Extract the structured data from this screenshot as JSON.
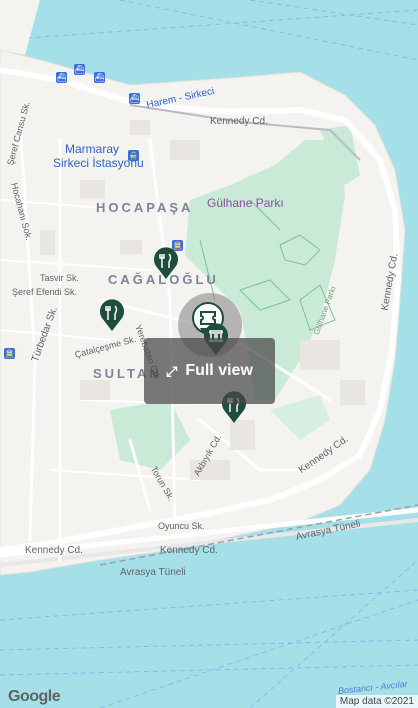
{
  "labels": {
    "kennedy_top": "Kennedy Cd.",
    "harem": "Harem - Sirkeci",
    "marmaray1": "Marmaray",
    "marmaray2": "Sirkeci İstasyonu",
    "hocapasa": "HOCAPAŞA",
    "gulhane": "Gülhane Parkı",
    "cagaloglu": "CAĞALOĞLU",
    "sultan": "SULTAN",
    "serif": "Şeref Cansu Sk.",
    "hocahani": "Hocahanı Sok.",
    "tasvir": "Tasvir Sk.",
    "seref": "Şeref Efendi Sk.",
    "turbedar": "Türbedar Sk.",
    "catalcesme": "Çatalçeşme Sk.",
    "yerebatan": "Yerebatan Cd.",
    "gulhane_parki_small": "Gülhane Parkı",
    "kennedy_right": "Kennedy Cd.",
    "kennedy_right2": "Kennedy Cd.",
    "torun": "Torun Sk.",
    "akbiyik": "Akbıyık Cd.",
    "oyuncu": "Oyuncu Sk.",
    "kennedy_bottom1": "Kennedy Cd.",
    "kennedy_bottom2": "Kennedy Cd.",
    "avrasya1": "Avrasya Tüneli",
    "avrasya2": "Avrasya Tüneli",
    "bostanci": "Bostancı - Avcılar"
  },
  "full_view": {
    "label": "Full view",
    "icon": "expand-icon"
  },
  "google_logo": "Google",
  "attribution": "Map data ©2021",
  "markers": [
    {
      "name": "restaurant-marker-1",
      "icon": "fork-knife-icon"
    },
    {
      "name": "restaurant-marker-2",
      "icon": "fork-knife-icon"
    },
    {
      "name": "attraction-marker-selected",
      "icon": "ticket-icon"
    },
    {
      "name": "museum-marker",
      "icon": "museum-icon"
    },
    {
      "name": "restaurant-marker-3",
      "icon": "fork-knife-icon"
    }
  ],
  "colors": {
    "water": "#a5e0e8",
    "land": "#f5f3f0",
    "park": "#c8ead6",
    "marker": "#1f4d3c",
    "road": "#ffffff"
  }
}
